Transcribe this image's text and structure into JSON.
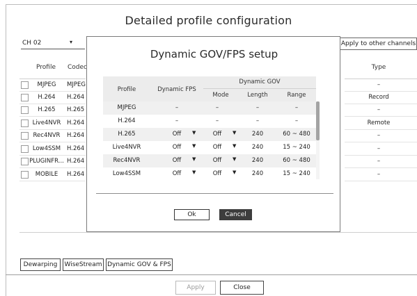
{
  "window": {
    "title": "Detailed profile configuration"
  },
  "channel_select": {
    "value": "CH 02"
  },
  "apply_other_label": "Apply to other channels",
  "profile_table": {
    "headers": {
      "profile": "Profile",
      "codec": "Codec",
      "type": "Type"
    },
    "rows": [
      {
        "profile": "MJPEG",
        "codec": "MJPEG",
        "type": "–"
      },
      {
        "profile": "H.264",
        "codec": "H.264",
        "type": "Record"
      },
      {
        "profile": "H.265",
        "codec": "H.265",
        "type": "–"
      },
      {
        "profile": "Live4NVR",
        "codec": "H.264",
        "type": "Remote"
      },
      {
        "profile": "Rec4NVR",
        "codec": "H.264",
        "type": "–"
      },
      {
        "profile": "Low4SSM",
        "codec": "H.264",
        "type": "–"
      },
      {
        "profile": "PLUGINFR...",
        "codec": "H.264",
        "type": "–"
      },
      {
        "profile": "MOBILE",
        "codec": "H.264",
        "type": "–"
      }
    ]
  },
  "dialog": {
    "title": "Dynamic GOV/FPS setup",
    "headers": {
      "profile": "Profile",
      "dynamic_fps": "Dynamic FPS",
      "dynamic_gov": "Dynamic GOV",
      "mode": "Mode",
      "length": "Length",
      "range": "Range"
    },
    "rows": [
      {
        "profile": "MJPEG",
        "fps": "–",
        "mode": "–",
        "length": "–",
        "range": "–",
        "dropdowns": false
      },
      {
        "profile": "H.264",
        "fps": "–",
        "mode": "–",
        "length": "–",
        "range": "–",
        "dropdowns": false
      },
      {
        "profile": "H.265",
        "fps": "Off",
        "mode": "Off",
        "length": "240",
        "range": "60 ~ 480",
        "dropdowns": true
      },
      {
        "profile": "Live4NVR",
        "fps": "Off",
        "mode": "Off",
        "length": "240",
        "range": "15 ~ 240",
        "dropdowns": true
      },
      {
        "profile": "Rec4NVR",
        "fps": "Off",
        "mode": "Off",
        "length": "240",
        "range": "60 ~ 480",
        "dropdowns": true
      },
      {
        "profile": "Low4SSM",
        "fps": "Off",
        "mode": "Off",
        "length": "240",
        "range": "15 ~ 240",
        "dropdowns": true
      }
    ],
    "ok_label": "Ok",
    "cancel_label": "Cancel"
  },
  "bottom_buttons": {
    "dewarping": "Dewarping",
    "wisestream": "WiseStream",
    "dynamic_gov_fps": "Dynamic GOV & FPS",
    "apply": "Apply",
    "close": "Close"
  },
  "colors": {
    "cancel_button_bg": "#3d3d3d",
    "disabled_text": "#9a9a9a",
    "header_bg": "#ececec"
  }
}
